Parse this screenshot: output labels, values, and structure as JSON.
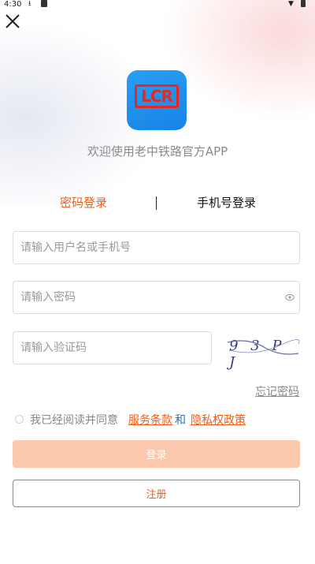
{
  "status_bar": {
    "time": "4:30",
    "icons": [
      "download-icon",
      "sd-card-icon",
      "wifi-icon",
      "battery-icon"
    ]
  },
  "header": {
    "close_icon": "close-icon"
  },
  "logo": {
    "text": "LCR",
    "bg_color": "#1e8ff0",
    "accent_color": "#e8281e"
  },
  "welcome_text": "欢迎使用老中铁路官方APP",
  "tabs": [
    {
      "label": "密码登录",
      "active": true
    },
    {
      "label": "手机号登录",
      "active": false
    }
  ],
  "form": {
    "username_placeholder": "请输入用户名或手机号",
    "username_value": "",
    "password_placeholder": "请输入密码",
    "password_value": "",
    "captcha_placeholder": "请输入验证码",
    "captcha_value": "",
    "captcha_image_text": "9 3 P J"
  },
  "forgot_password": "忘记密码",
  "agreement": {
    "checked": false,
    "prefix": "我已经阅读并同意",
    "terms_link": "服务条款",
    "and": "和",
    "privacy_link": "隐私权政策"
  },
  "buttons": {
    "login": "登录",
    "register": "注册"
  },
  "colors": {
    "accent": "#f25c14",
    "login_disabled": "#fbc8ad"
  }
}
